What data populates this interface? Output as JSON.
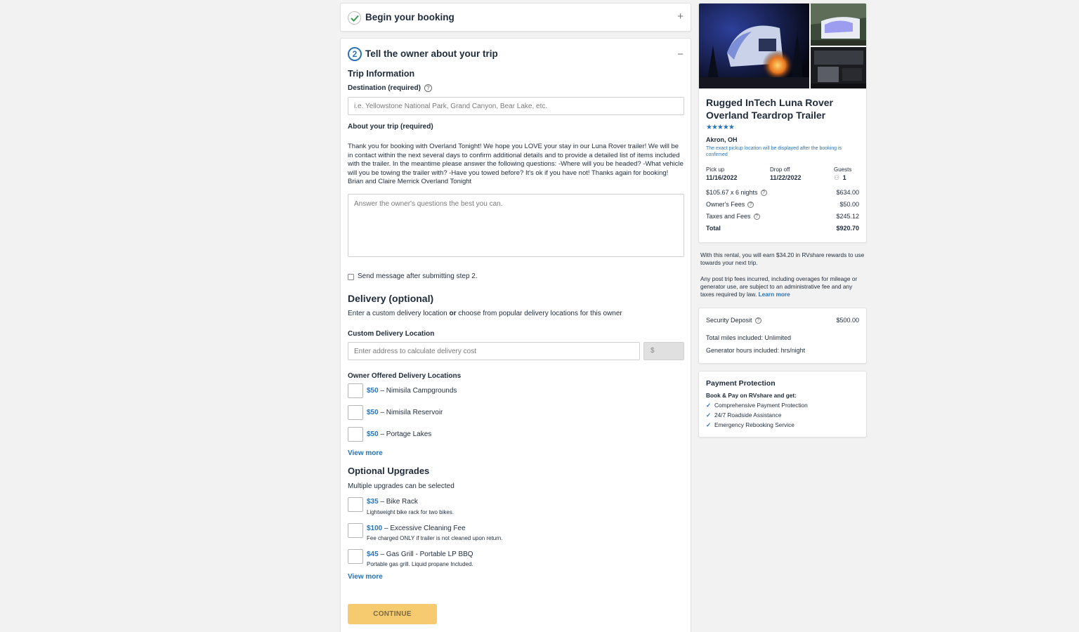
{
  "step1": {
    "title": "Begin your booking",
    "toggle": "+"
  },
  "step2": {
    "number": "2",
    "title": "Tell the owner about your trip",
    "toggle": "−",
    "trip_info_heading": "Trip Information",
    "destination_label": "Destination (required)",
    "destination_placeholder": "i.e. Yellowstone National Park, Grand Canyon, Bear Lake, etc.",
    "about_label": "About your trip (required)",
    "owner_message": "Thank you for booking with Overland Tonight! We hope you LOVE your stay in our Luna Rover trailer! We will be in contact within the next several days to confirm additional details and to provide a detailed list of items included with the trailer. In the meantime please answer the following questions: -Where will you be headed? -What vehicle will you be towing the trailer with? -Have you towed before? It's ok if you have not! Thanks again for booking! Brian and Claire Merrick Overland Tonight",
    "answer_placeholder": "Answer the owner's questions the best you can.",
    "send_message_label": "Send message after submitting step 2.",
    "delivery_heading": "Delivery (optional)",
    "delivery_desc_pre": "Enter a custom delivery location ",
    "delivery_desc_or": "or",
    "delivery_desc_post": " choose from popular delivery locations for this owner",
    "custom_delivery_label": "Custom Delivery Location",
    "custom_delivery_placeholder": "Enter address to calculate delivery cost",
    "delivery_cost_prefix": "$",
    "owner_locations_label": "Owner Offered Delivery Locations",
    "locations": [
      {
        "price": "$50",
        "name": " – Nimisila Campgrounds"
      },
      {
        "price": "$50",
        "name": " – Nimisila Reservoir"
      },
      {
        "price": "$50",
        "name": " – Portage Lakes"
      }
    ],
    "view_more_locations": "View more",
    "upgrades_heading": "Optional Upgrades",
    "upgrades_desc": "Multiple upgrades can be selected",
    "upgrades": [
      {
        "price": "$35",
        "name": " – Bike Rack",
        "desc": "Lightweight bike rack for two bikes."
      },
      {
        "price": "$100",
        "name": " – Excessive Cleaning Fee",
        "desc": "Fee charged ONLY if trailer is not cleaned upon return."
      },
      {
        "price": "$45",
        "name": " – Gas Grill - Portable LP BBQ",
        "desc": "Portable gas grill. Liquid propane Included."
      }
    ],
    "view_more_upgrades": "View more",
    "continue_label": "CONTINUE"
  },
  "listing": {
    "title": "Rugged InTech Luna Rover Overland Teardrop Trailer",
    "rating_stars": "★★★★★",
    "location": "Akron, OH",
    "pickup_note": "The exact pickup location will be displayed after the booking is confirmed",
    "pickup_label": "Pick up",
    "pickup_date": "11/16/2022",
    "dropoff_label": "Drop off",
    "dropoff_date": "11/22/2022",
    "guests_label": "Guests",
    "guests_count": "1",
    "fees": [
      {
        "label": "$105.67 x 6 nights",
        "value": "$634.00",
        "help": true
      },
      {
        "label": "Owner's Fees",
        "value": "$50.00",
        "help": true
      },
      {
        "label": "Taxes and Fees",
        "value": "$245.12",
        "help": true
      }
    ],
    "total_label": "Total",
    "total_value": "$920.70"
  },
  "rewards_note": "With this rental, you will earn $34.20 in RVshare rewards to use towards your next trip.",
  "post_trip_note": "Any post trip fees incurred, including overages for mileage or generator use, are subject to an administrative fee and any taxes required by law. ",
  "learn_more": "Learn more",
  "deposit": {
    "label": "Security Deposit",
    "value": "$500.00",
    "miles": "Total miles included: Unlimited",
    "generator": "Generator hours included: hrs/night"
  },
  "protection": {
    "title": "Payment Protection",
    "subtitle": "Book & Pay on RVshare and get:",
    "items": [
      "Comprehensive Payment Protection",
      "24/7 Roadside Assistance",
      "Emergency Rebooking Service"
    ]
  },
  "colors": {
    "accent": "#2a73b5",
    "button": "#f6cb6f",
    "background": "#f2f2f2"
  }
}
